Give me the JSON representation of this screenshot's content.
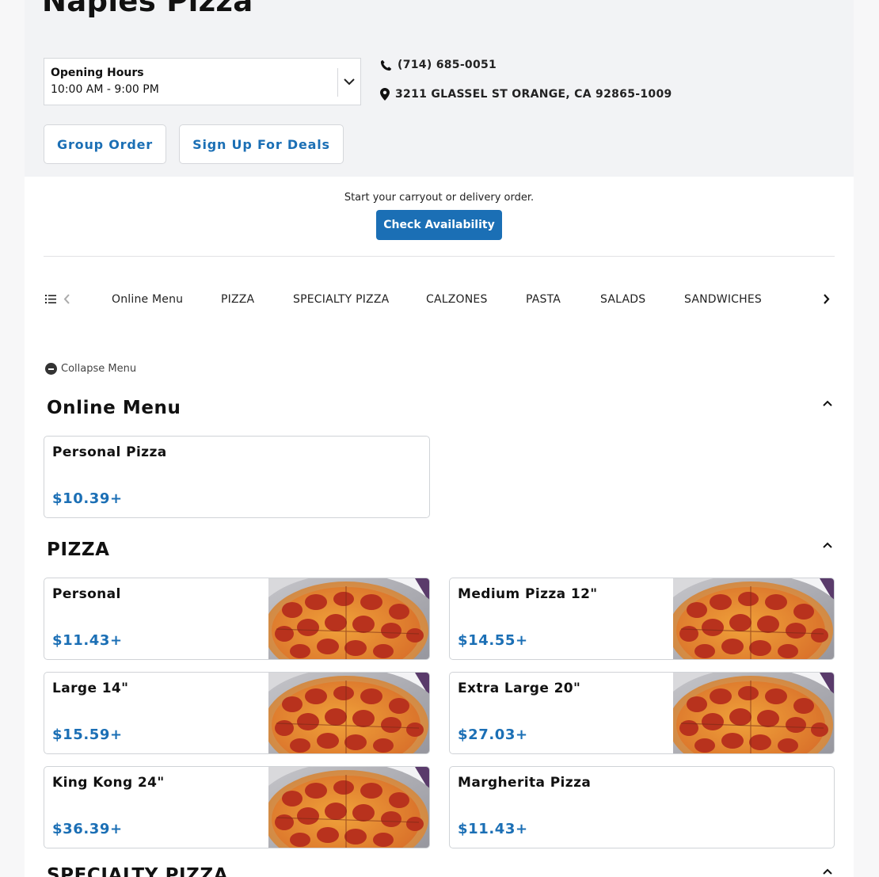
{
  "restaurant": {
    "name": "Naples Pizza",
    "hours_label": "Opening Hours",
    "hours_value": "10:00 AM - 9:00 PM",
    "phone": "(714) 685-0051",
    "address": "3211 GLASSEL ST ORANGE, CA 92865-1009"
  },
  "actions": {
    "group_order": "Group Order",
    "sign_up_deals": "Sign Up For Deals"
  },
  "order": {
    "prompt": "Start your carryout or delivery order.",
    "check_availability": "Check Availability"
  },
  "nav": {
    "items": [
      "Online Menu",
      "PIZZA",
      "SPECIALTY PIZZA",
      "CALZONES",
      "PASTA",
      "SALADS",
      "SANDWICHES"
    ]
  },
  "menu": {
    "collapse_label": "Collapse Menu",
    "sections": [
      {
        "title": "Online Menu",
        "items": [
          {
            "name": "Personal Pizza",
            "price": "$10.39+",
            "has_image": false
          }
        ]
      },
      {
        "title": "PIZZA",
        "items": [
          {
            "name": "Personal",
            "price": "$11.43+",
            "has_image": true
          },
          {
            "name": "Medium Pizza 12\"",
            "price": "$14.55+",
            "has_image": true
          },
          {
            "name": "Large 14\"",
            "price": "$15.59+",
            "has_image": true
          },
          {
            "name": "Extra Large 20\"",
            "price": "$27.03+",
            "has_image": true
          },
          {
            "name": "King Kong 24\"",
            "price": "$36.39+",
            "has_image": true
          },
          {
            "name": "Margherita Pizza",
            "price": "$11.43+",
            "has_image": false
          }
        ]
      },
      {
        "title": "SPECIALTY PIZZA",
        "items": []
      }
    ]
  },
  "colors": {
    "accent": "#1b6fb5",
    "header_bg": "#f2f3f5"
  },
  "icons": {
    "phone": "phone-icon",
    "location": "map-pin-icon",
    "hours_toggle": "chevron-down-icon",
    "menu_list": "list-icon",
    "nav_prev": "chevron-left-icon",
    "nav_next": "chevron-right-icon",
    "section_toggle": "chevron-up-icon",
    "collapse": "minus-circle-icon"
  }
}
